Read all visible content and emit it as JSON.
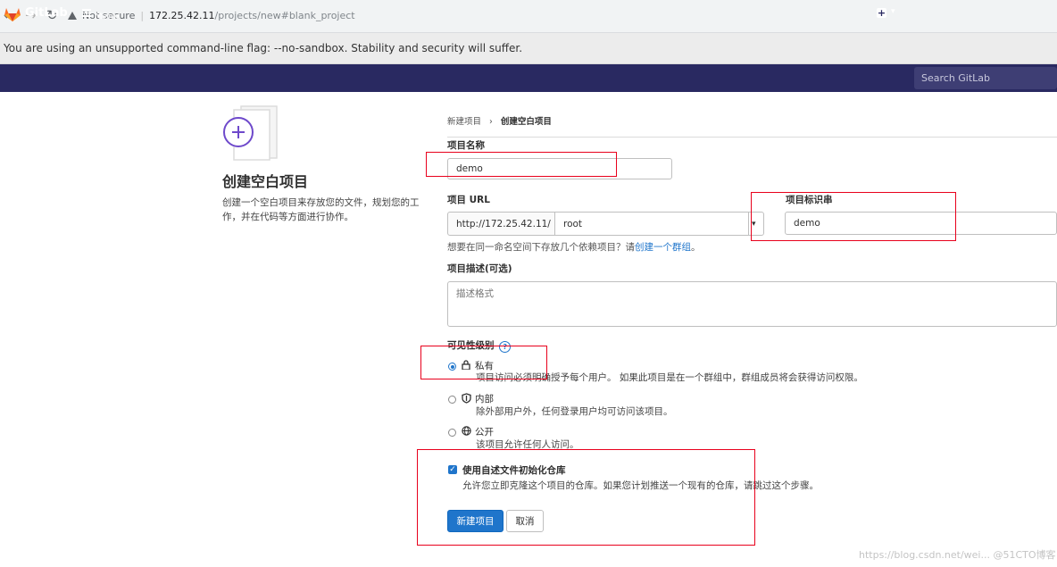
{
  "browser": {
    "security_label": "Not secure",
    "url_host": "172.25.42.11",
    "url_path": "/projects/new#blank_project",
    "info_bar": "You are using an unsupported command-line flag: --no-sandbox. Stability and security will suffer."
  },
  "header": {
    "brand": "GitLab",
    "menu_label": "Menu",
    "search_placeholder": "Search GitLab"
  },
  "left": {
    "title": "创建空白项目",
    "description": "创建一个空白项目来存放您的文件，规划您的工作，并在代码等方面进行协作。"
  },
  "breadcrumb": {
    "parent": "新建项目",
    "separator": "›",
    "current": "创建空白项目"
  },
  "form": {
    "name_label": "项目名称",
    "name_value": "demo",
    "url_label": "项目 URL",
    "url_prefix": "http://172.25.42.11/",
    "namespace_value": "root",
    "slug_label": "项目标识串",
    "slug_value": "demo",
    "group_hint_prefix": "想要在同一命名空间下存放几个依赖项目？请",
    "group_hint_link": "创建一个群组",
    "group_hint_suffix": "。",
    "desc_label": "项目描述(可选)",
    "desc_placeholder": "描述格式",
    "visibility_label": "可见性级别",
    "visibility_help": "?",
    "visibility_options": [
      {
        "title": "私有",
        "desc": "项目访问必须明确授予每个用户。 如果此项目是在一个群组中，群组成员将会获得访问权限。",
        "selected": true
      },
      {
        "title": "内部",
        "desc": "除外部用户外，任何登录用户均可访问该项目。",
        "selected": false
      },
      {
        "title": "公开",
        "desc": "该项目允许任何人访问。",
        "selected": false
      }
    ],
    "readme_label": "使用自述文件初始化仓库",
    "readme_checked": true,
    "readme_desc": "允许您立即克隆这个项目的仓库。如果您计划推送一个现有的仓库，请跳过这个步骤。",
    "create_button": "新建项目",
    "cancel_button": "取消"
  },
  "watermark": "https://blog.csdn.net/wei... @51CTO博客",
  "colors": {
    "header_bg": "#292961",
    "primary": "#1f75cb",
    "highlight": "#e8001c"
  }
}
